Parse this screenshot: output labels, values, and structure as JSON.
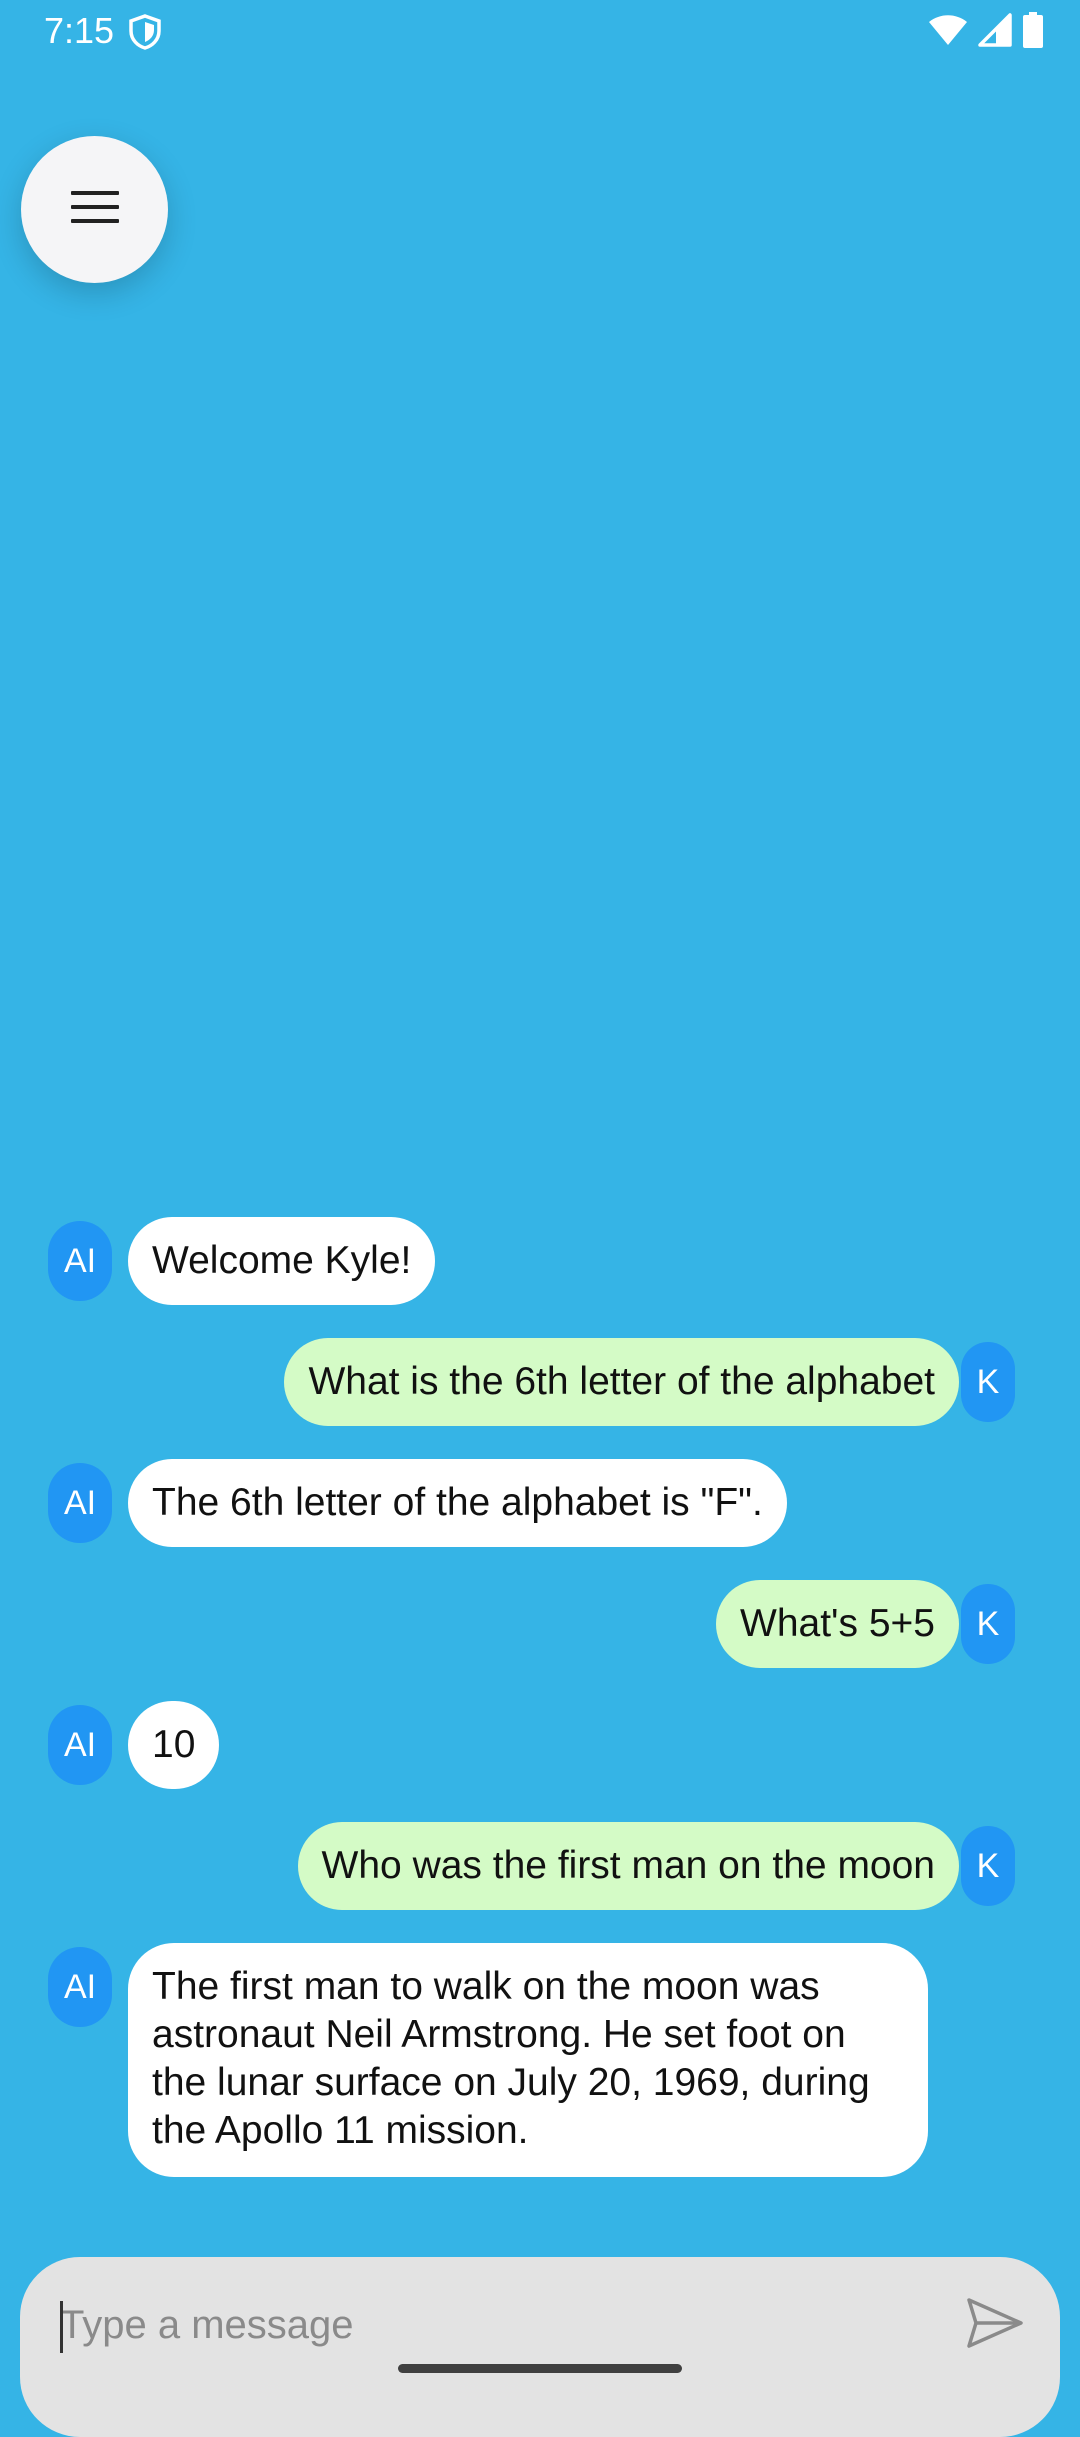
{
  "status_bar": {
    "time": "7:15",
    "icons": [
      "shield-icon",
      "wifi-icon",
      "signal-icon",
      "battery-icon"
    ]
  },
  "menu_button": {
    "icon": "hamburger-menu-icon"
  },
  "messages": [
    {
      "sender": "ai",
      "avatar": "AI",
      "text": "Welcome Kyle!"
    },
    {
      "sender": "user",
      "avatar": "K",
      "text": "What is the 6th letter of the alphabet"
    },
    {
      "sender": "ai",
      "avatar": "AI",
      "text": "The 6th letter of the alphabet is \"F\"."
    },
    {
      "sender": "user",
      "avatar": "K",
      "text": "What's 5+5"
    },
    {
      "sender": "ai",
      "avatar": "AI",
      "text": "10"
    },
    {
      "sender": "user",
      "avatar": "K",
      "text": "Who was the first man on the moon"
    },
    {
      "sender": "ai",
      "avatar": "AI",
      "text": "The first man to walk on the moon was astronaut Neil Armstrong. He set foot on the lunar surface on July 20, 1969, during the Apollo 11 mission."
    }
  ],
  "composer": {
    "placeholder": "Type a message",
    "value": "",
    "send_icon": "send-icon"
  },
  "colors": {
    "background": "#35b4e6",
    "ai_bubble": "#ffffff",
    "user_bubble": "#d4fbc6",
    "avatar": "#2196f3",
    "composer": "#e3e3e3"
  }
}
